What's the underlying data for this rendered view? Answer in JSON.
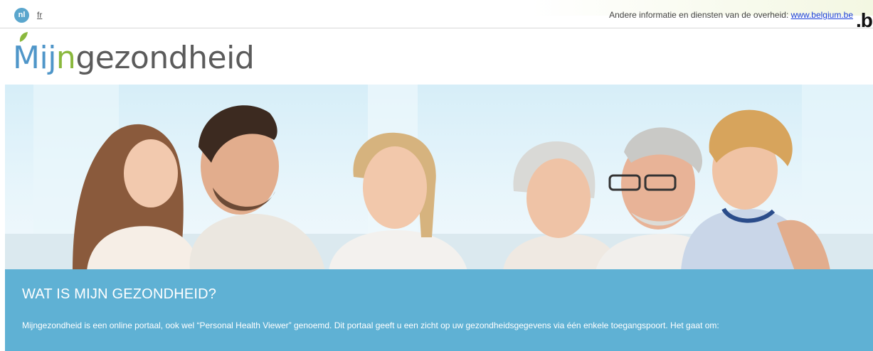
{
  "top_bar": {
    "active_language": "nl",
    "alt_language": "fr",
    "gov_info_text": "Andere informatie en diensten van de overheid:",
    "gov_link_text": "www.belgium.be",
    "be_logo_text": ".be"
  },
  "logo": {
    "part1": "Mij",
    "part2": "n",
    "part3": "gezondheid",
    "leaf_color": "#8ab83d"
  },
  "hero": {
    "image_description_icon": "family-photo-image"
  },
  "info": {
    "title": "WAT IS MIJN GEZONDHEID?",
    "text": "Mijngezondheid is een online portaal, ook wel “Personal Health Viewer” genoemd. Dit portaal geeft u een zicht op uw gezondheidsgegevens via één enkele toegangspoort. Het gaat om:"
  },
  "colors": {
    "accent_blue": "#5fb1d4",
    "logo_blue": "#4f96c9",
    "logo_green": "#8ab83d",
    "link": "#1a3fd6"
  }
}
